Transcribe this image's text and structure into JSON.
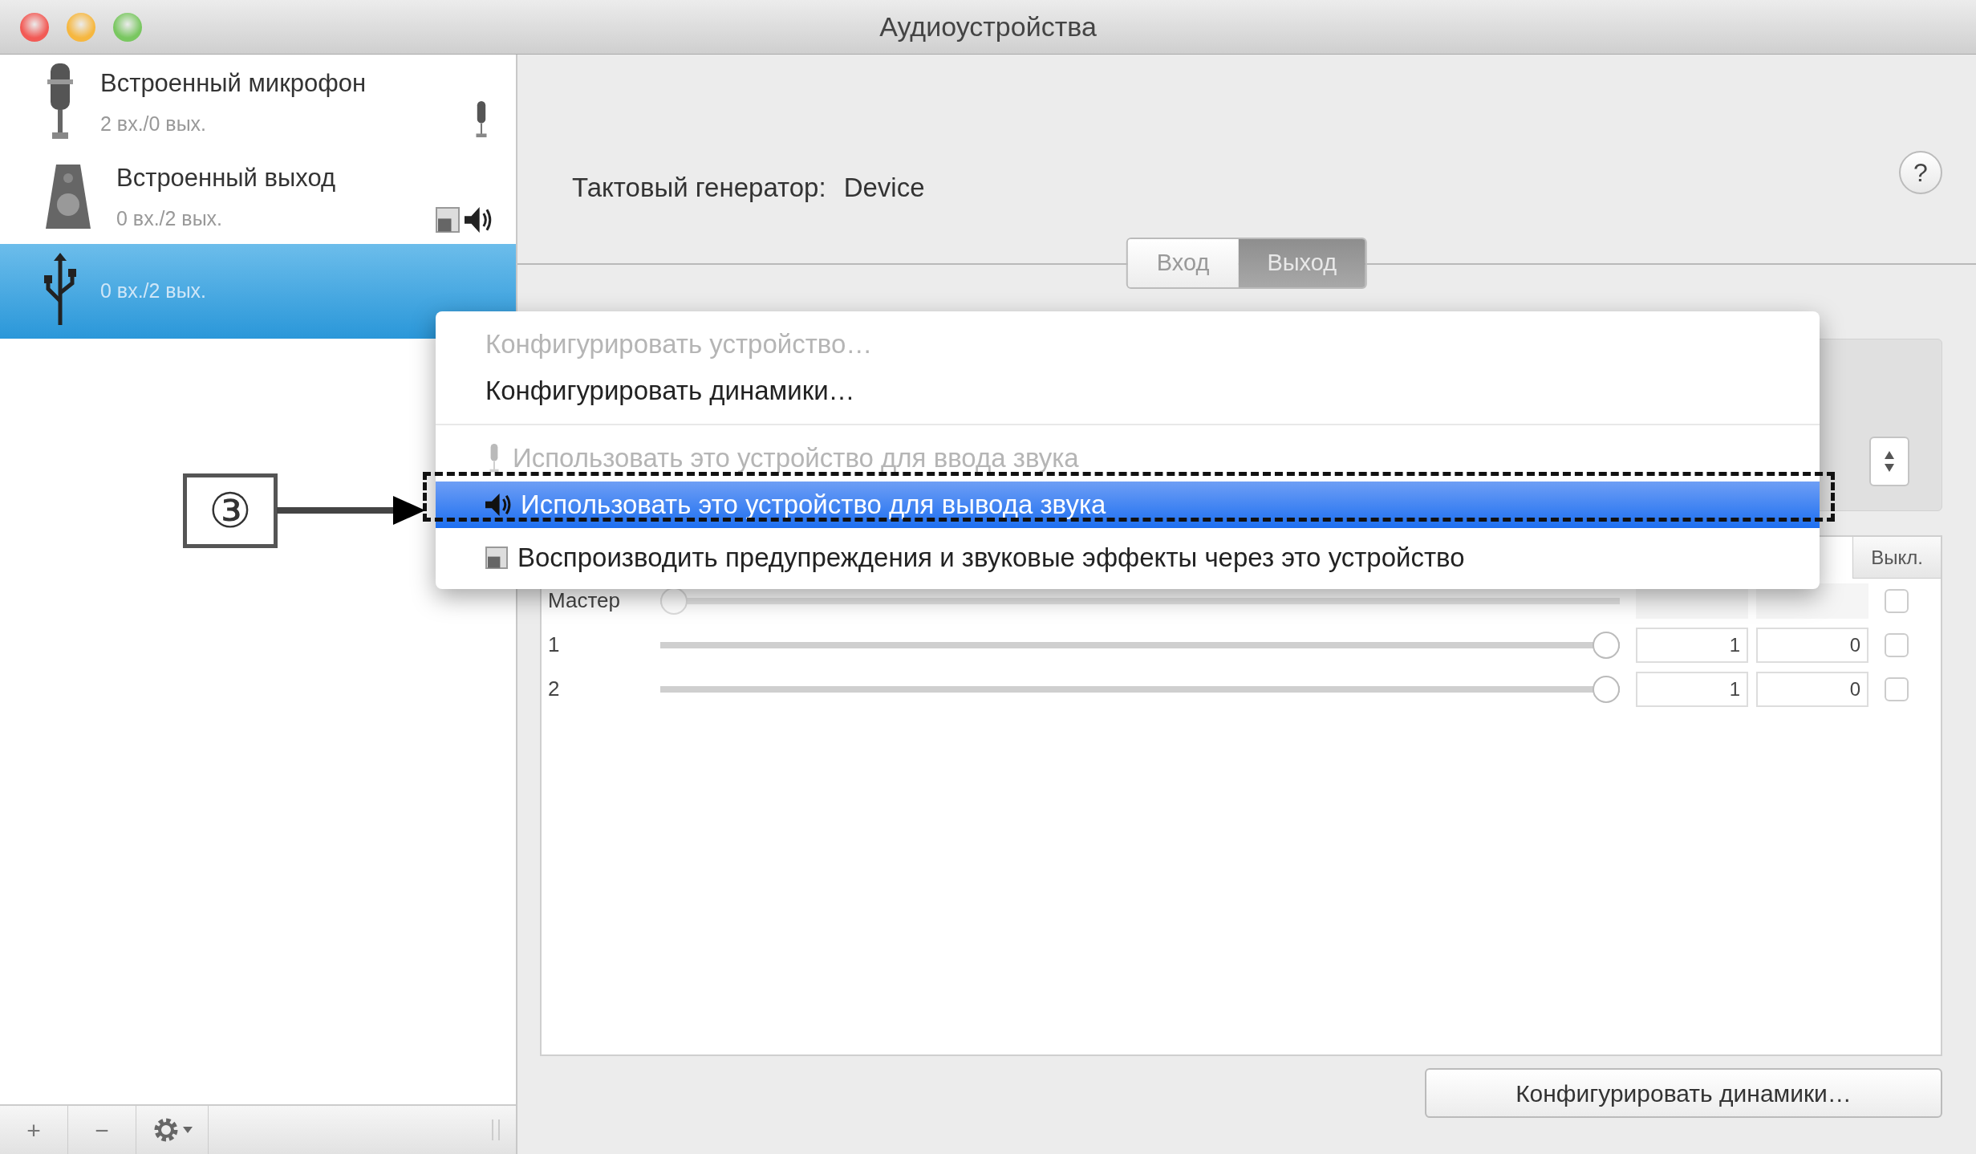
{
  "window": {
    "title": "Аудиоустройства"
  },
  "devices": [
    {
      "kind": "microphone",
      "name": "Встроенный микрофон",
      "channels": "2 вх./0 вых.",
      "selected": false,
      "default_input": true,
      "default_output": false,
      "default_alerts": false
    },
    {
      "kind": "speaker",
      "name": "Встроенный выход",
      "channels": "0 вх./2 вых.",
      "selected": false,
      "default_input": false,
      "default_output": true,
      "default_alerts": true
    },
    {
      "kind": "usb",
      "channels": "0 вх./2 вых.",
      "selected": true,
      "default_input": false,
      "default_output": false,
      "default_alerts": false
    }
  ],
  "toolbar": {
    "add": "+",
    "remove": "−"
  },
  "clock_source": {
    "label": "Тактовый генератор:",
    "value": "Device"
  },
  "help": "?",
  "tabs": [
    {
      "label": "Вход",
      "selected": false
    },
    {
      "label": "Выход",
      "selected": true
    }
  ],
  "volume_table": {
    "mute_heading": "Выкл.",
    "rows": [
      {
        "kind": "master",
        "label": "Мастер",
        "level": 0,
        "disabled": true,
        "muted": false
      },
      {
        "kind": "channel",
        "label": "1",
        "level": 1,
        "disabled": false,
        "value": "1",
        "db": "0",
        "muted": false
      },
      {
        "kind": "channel",
        "label": "2",
        "level": 1,
        "disabled": false,
        "value": "1",
        "db": "0",
        "muted": false
      }
    ]
  },
  "configure_button": "Конфигурировать динамики…",
  "context_menu": [
    {
      "kind": "command",
      "label": "Конфигурировать устройство…",
      "disabled": true,
      "selected": false
    },
    {
      "kind": "command",
      "label": "Конфигурировать динамики…",
      "disabled": false,
      "selected": false
    },
    {
      "kind": "separator"
    },
    {
      "kind": "input",
      "label": "Использовать это устройство для ввода звука",
      "disabled": true,
      "selected": false
    },
    {
      "kind": "output",
      "label": "Использовать это устройство для вывода звука",
      "disabled": false,
      "selected": true
    },
    {
      "kind": "alerts",
      "label": "Воспроизводить предупреждения и звуковые эффекты через это устройство",
      "disabled": false,
      "selected": false
    }
  ],
  "callout": {
    "label": "③"
  }
}
